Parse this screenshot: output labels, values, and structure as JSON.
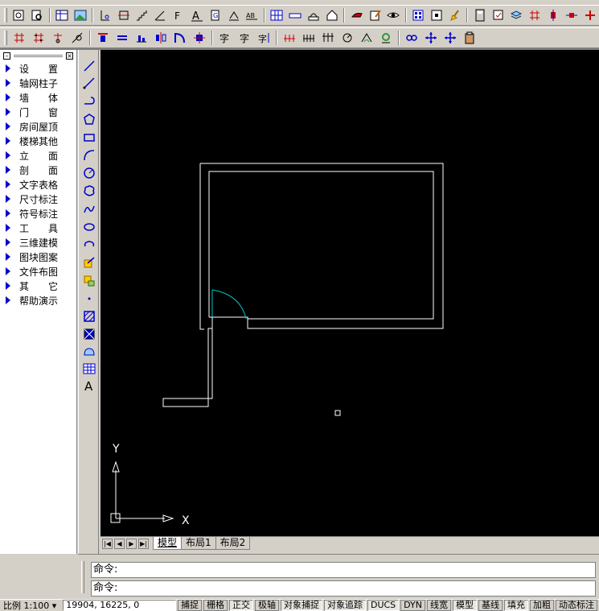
{
  "sidebar": {
    "items": [
      {
        "label": "设　　置"
      },
      {
        "label": "轴网柱子"
      },
      {
        "label": "墙　　体"
      },
      {
        "label": "门　　窗"
      },
      {
        "label": "房间屋顶"
      },
      {
        "label": "楼梯其他"
      },
      {
        "label": "立　　面"
      },
      {
        "label": "剖　　面"
      },
      {
        "label": "文字表格"
      },
      {
        "label": "尺寸标注"
      },
      {
        "label": "符号标注"
      },
      {
        "label": "工　　具"
      },
      {
        "label": "三维建模"
      },
      {
        "label": "图块图案"
      },
      {
        "label": "文件布图"
      },
      {
        "label": "其　　它"
      },
      {
        "label": "帮助演示"
      }
    ]
  },
  "canvas": {
    "ucs_x_label": "X",
    "ucs_y_label": "Y"
  },
  "layout_tabs": [
    "模型",
    "布局1",
    "布局2"
  ],
  "command": {
    "prompt1": "命令:",
    "prompt2": "命令:"
  },
  "status": {
    "scale": "比例 1:100 ▾",
    "coords": "19904, 16225, 0",
    "toggles": [
      "捕捉",
      "栅格",
      "正交",
      "极轴",
      "对象捕捉",
      "对象追踪",
      "DUCS",
      "DYN",
      "线宽",
      "模型",
      "基线",
      "填充",
      "加粗",
      "动态标注"
    ]
  },
  "colors": {
    "canvas_bg": "#000000",
    "wall_line": "#ffffff",
    "door_arc": "#00c8c8",
    "menu_triangle": "#0000cc"
  },
  "icons": {
    "draw_tools": [
      "line-icon",
      "polyline-icon",
      "spline-icon",
      "polygon-icon",
      "rectangle-icon",
      "arc-icon",
      "circle-icon",
      "revcloud-icon",
      "curve-icon",
      "ellipse-icon",
      "ellipse-arc-icon",
      "insert-block-icon",
      "make-block-icon",
      "point-icon",
      "hatch-icon",
      "gradient-icon",
      "region-icon",
      "table-icon",
      "multiline-text-icon"
    ]
  }
}
